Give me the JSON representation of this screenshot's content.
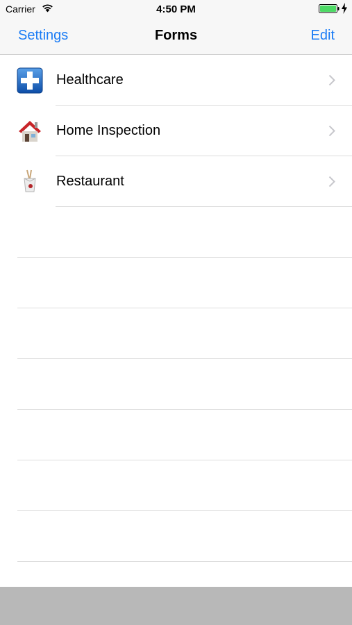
{
  "status_bar": {
    "carrier": "Carrier",
    "time": "4:50 PM",
    "wifi_icon": "wifi-icon",
    "battery_icon": "battery-icon",
    "battery_color": "#4cd964"
  },
  "nav": {
    "left_label": "Settings",
    "title": "Forms",
    "right_label": "Edit",
    "accent_color": "#1b7cf5"
  },
  "forms": [
    {
      "label": "Healthcare",
      "icon": "medical-cross-icon"
    },
    {
      "label": "Home Inspection",
      "icon": "house-icon"
    },
    {
      "label": "Restaurant",
      "icon": "takeout-box-icon"
    }
  ]
}
